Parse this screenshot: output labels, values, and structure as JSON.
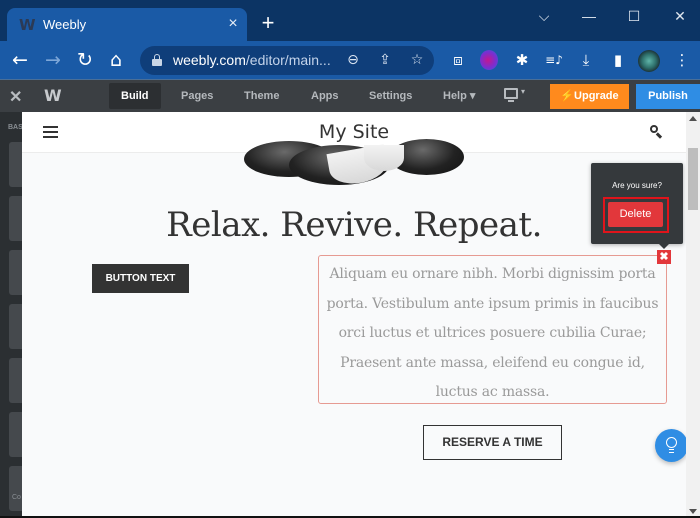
{
  "browser": {
    "tab": {
      "title": "Weebly",
      "favicon": "weebly-logo-icon",
      "close_label": "×"
    },
    "new_tab_label": "+",
    "window_controls": {
      "dropdown": "⌵",
      "minimize": "—",
      "maximize": "☐",
      "close": "✕"
    },
    "nav": {
      "back": "←",
      "forward": "→",
      "reload": "↻",
      "home": "⌂"
    },
    "address": {
      "domain": "weebly.com",
      "path": "/editor/main...",
      "zoom_icon": "⊖",
      "share_icon": "⇪",
      "bookmark_icon": "☆"
    },
    "extensions": {
      "screenshot_icon": "⧈",
      "extension_puzzle_icon": "✱",
      "media_icon": "≡♪",
      "download_icon": "⤓",
      "sidepanel_icon": "▮",
      "menu_icon": "⋮"
    }
  },
  "editor": {
    "close_label": "✕",
    "logo": "W",
    "tabs": [
      {
        "label": "Build",
        "active": true
      },
      {
        "label": "Pages",
        "active": false
      },
      {
        "label": "Theme",
        "active": false
      },
      {
        "label": "Apps",
        "active": false
      },
      {
        "label": "Settings",
        "active": false
      },
      {
        "label": "Help ▾",
        "active": false
      }
    ],
    "device_caret": "▾",
    "upgrade_label": "⚡Upgrade",
    "publish_label": "Publish",
    "colors": {
      "upgrade": "#ff8a1d",
      "publish": "#2f8de4",
      "delete": "#e2373b"
    }
  },
  "sidebar": {
    "heading": "BAS",
    "bottom_label": "Co"
  },
  "site": {
    "title": "My Site",
    "heading": "Relax. Revive. Repeat.",
    "button_text": "BUTTON TEXT",
    "paragraph": [
      "Aliquam eu ornare nibh. Morbi dignissim porta",
      "porta. Vestibulum ante ipsum primis in faucibus",
      "orci luctus et ultrices posuere cubilia Curae;",
      "Praesent ante massa, eleifend eu congue id,",
      "luctus ac massa."
    ],
    "reserve_button": "RESERVE A TIME",
    "block_delete_label": "✖"
  },
  "confirm": {
    "question": "Are you sure?",
    "delete_label": "Delete"
  }
}
